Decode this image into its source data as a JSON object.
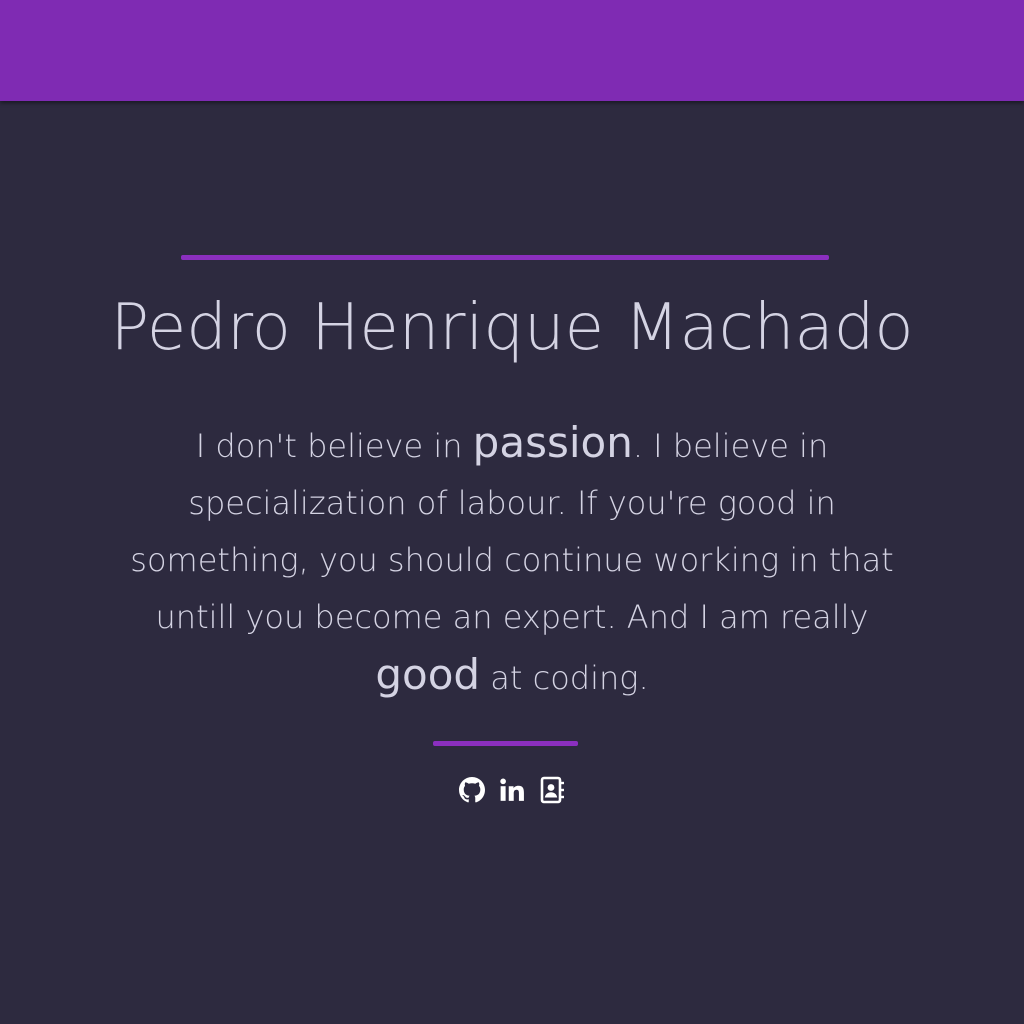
{
  "header": {
    "bar_color": "#7f2bb3"
  },
  "profile": {
    "name": "Pedro Henrique Machado",
    "bio": {
      "part1": "I don't believe in ",
      "emphasis1": "passion",
      "part2": ". I believe in specialization of labour. If you're good in something, you should continue working in that untill you become an expert. And I am really ",
      "emphasis2": "good",
      "part3": " at coding."
    }
  },
  "accent_color": "#8b2fbf",
  "socials": [
    {
      "icon": "github-icon"
    },
    {
      "icon": "linkedin-icon"
    },
    {
      "icon": "contact-book-icon"
    }
  ]
}
